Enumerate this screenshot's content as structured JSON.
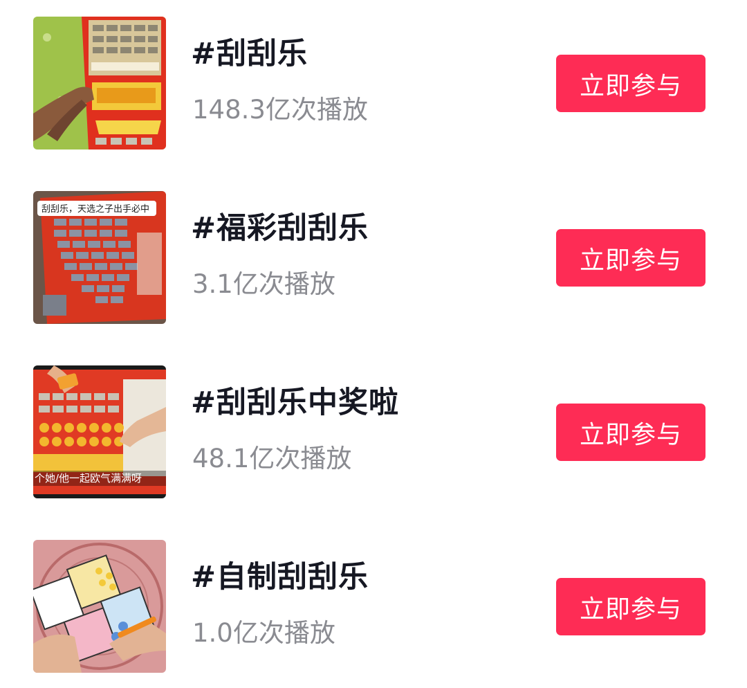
{
  "colors": {
    "accent": "#fe2c55",
    "title_text": "#161823",
    "meta_text": "#8a8b91",
    "button_text": "#ffffff"
  },
  "topics": [
    {
      "title": "#刮刮乐",
      "plays": "148.3亿次播放",
      "button_label": "立即参与",
      "thumb_overlay": ""
    },
    {
      "title": "#福彩刮刮乐",
      "plays": "3.1亿次播放",
      "button_label": "立即参与",
      "thumb_overlay": "刮刮乐，天选之子出手必中"
    },
    {
      "title": "#刮刮乐中奖啦",
      "plays": "48.1亿次播放",
      "button_label": "立即参与",
      "thumb_overlay": "个她/他一起欧气满满呀"
    },
    {
      "title": "#自制刮刮乐",
      "plays": "1.0亿次播放",
      "button_label": "立即参与",
      "thumb_overlay": ""
    }
  ]
}
